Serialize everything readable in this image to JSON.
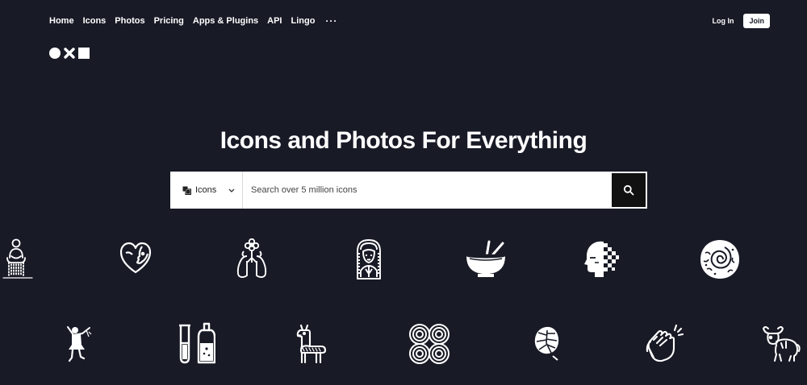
{
  "nav": {
    "items": [
      {
        "label": "Home"
      },
      {
        "label": "Icons"
      },
      {
        "label": "Photos"
      },
      {
        "label": "Pricing"
      },
      {
        "label": "Apps & Plugins"
      },
      {
        "label": "API"
      },
      {
        "label": "Lingo"
      }
    ],
    "more_label": "···",
    "login_label": "Log In",
    "join_label": "Join"
  },
  "hero": {
    "title": "Icons and Photos For Everything"
  },
  "search": {
    "type_label": "Icons",
    "placeholder": "Search over 5 million icons",
    "value": ""
  },
  "icons_row1": [
    "meditating-person-icon",
    "heart-face-icon",
    "lungs-flower-icon",
    "woman-portrait-icon",
    "bowl-chopsticks-icon",
    "pixel-head-icon",
    "ammonite-fossil-icon"
  ],
  "icons_row2": [
    "dancer-icon",
    "test-tube-bottle-icon",
    "llama-icon",
    "concentric-circles-icon",
    "monstera-leaf-icon",
    "clapping-hands-icon",
    "bull-icon"
  ],
  "colors": {
    "background": "#181a26",
    "text": "#ffffff",
    "search_button": "#111111"
  }
}
